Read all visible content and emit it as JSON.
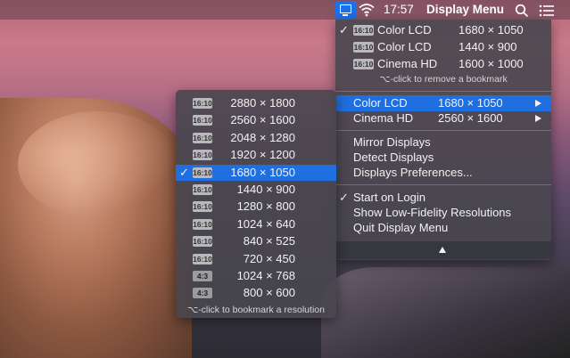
{
  "menubar": {
    "time": "17:57",
    "app_title": "Display Menu"
  },
  "main_menu": {
    "bookmarks": [
      {
        "checked": true,
        "badge": "16:10",
        "name": "Color LCD",
        "resolution": "1680 × 1050"
      },
      {
        "checked": false,
        "badge": "16:10",
        "name": "Color LCD",
        "resolution": "1440 × 900"
      },
      {
        "checked": false,
        "badge": "16:10",
        "name": "Cinema HD",
        "resolution": "1600 × 1000"
      }
    ],
    "bookmark_hint": "⌥-click to remove a bookmark",
    "displays": [
      {
        "name": "Color LCD",
        "resolution": "1680 × 1050",
        "selected": true
      },
      {
        "name": "Cinema HD",
        "resolution": "2560 × 1600",
        "selected": false
      }
    ],
    "actions": [
      "Mirror Displays",
      "Detect Displays",
      "Displays Preferences..."
    ],
    "options": [
      {
        "checked": true,
        "label": "Start on Login"
      },
      {
        "checked": false,
        "label": "Show Low-Fidelity Resolutions"
      },
      {
        "checked": false,
        "label": "Quit Display Menu"
      }
    ]
  },
  "sub_menu": {
    "resolutions": [
      {
        "badge": "16:10",
        "resolution": "2880 × 1800",
        "checked": false
      },
      {
        "badge": "16:10",
        "resolution": "2560 × 1600",
        "checked": false
      },
      {
        "badge": "16:10",
        "resolution": "2048 × 1280",
        "checked": false
      },
      {
        "badge": "16:10",
        "resolution": "1920 × 1200",
        "checked": false
      },
      {
        "badge": "16:10",
        "resolution": "1680 × 1050",
        "checked": true
      },
      {
        "badge": "16:10",
        "resolution": "1440 × 900",
        "checked": false
      },
      {
        "badge": "16:10",
        "resolution": "1280 × 800",
        "checked": false
      },
      {
        "badge": "16:10",
        "resolution": "1024 × 640",
        "checked": false
      },
      {
        "badge": "16:10",
        "resolution": "840 × 525",
        "checked": false
      },
      {
        "badge": "16:10",
        "resolution": "720 × 450",
        "checked": false
      },
      {
        "badge": "4:3",
        "resolution": "1024 × 768",
        "checked": false
      },
      {
        "badge": "4:3",
        "resolution": "800 × 600",
        "checked": false
      }
    ],
    "hint": "⌥-click to bookmark a resolution"
  },
  "colors": {
    "selection": "#1f6fe0",
    "menu_bg": "#48464e"
  },
  "icons": {
    "check": "✓",
    "display": "display-icon",
    "wifi": "wifi-icon",
    "search": "search-icon",
    "list": "list-icon"
  }
}
